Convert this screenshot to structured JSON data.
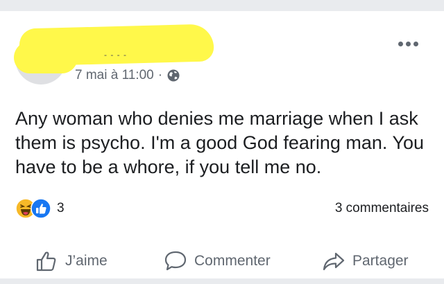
{
  "post": {
    "author_redacted": "- - - -",
    "timestamp": "7 mai à 11:00",
    "separator": "·",
    "privacy_icon": "globe-icon",
    "text": "Any woman who denies me marriage when I ask them is psycho. I'm a good God fearing man. You have to be a whore, if you tell me no."
  },
  "stats": {
    "reaction_count": "3",
    "comments": "3 commentaires",
    "reaction_icons": [
      "haha-icon",
      "like-icon"
    ]
  },
  "actions": {
    "like": "J’aime",
    "comment": "Commenter",
    "share": "Partager"
  },
  "colors": {
    "redaction": "#fff84a",
    "like_blue": "#1877f2",
    "haha_yellow": "#f7b928",
    "muted_text": "#606770"
  }
}
